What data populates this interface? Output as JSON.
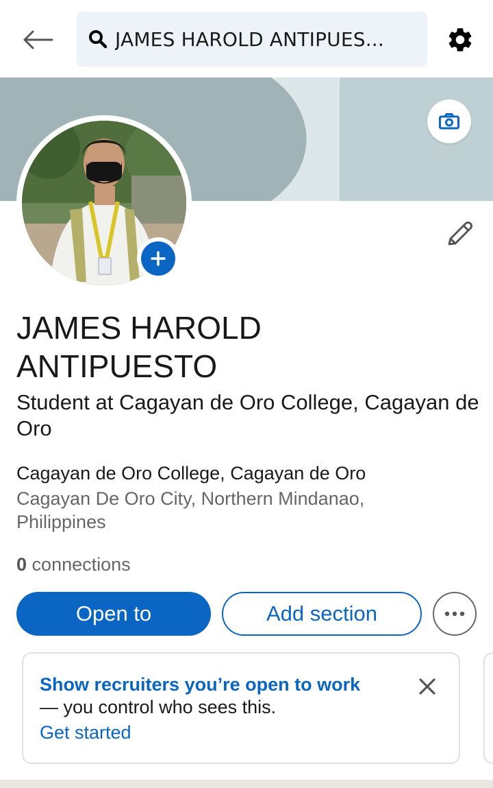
{
  "search": {
    "query": "JAMES HAROLD ANTIPUES..."
  },
  "profile": {
    "name_line1": "JAMES HAROLD",
    "name_line2": "ANTIPUESTO",
    "headline": "Student at Cagayan de Oro College,  Cagayan de Oro",
    "education": "Cagayan de Oro College,  Cagayan de Oro",
    "location": "Cagayan De Oro City, Northern Mindanao, Philippines",
    "connections_count": "0",
    "connections_label": "connections"
  },
  "actions": {
    "open_to": "Open to",
    "add_section": "Add section"
  },
  "open_to_work_card": {
    "title": "Show recruiters you’re open to work",
    "subtitle": "— you control who sees this.",
    "link": "Get started"
  },
  "icons": {
    "back": "arrow-left-icon",
    "search": "search-icon",
    "settings": "gear-icon",
    "camera": "camera-icon",
    "add_photo": "plus-icon",
    "edit": "pencil-icon",
    "more": "ellipsis-icon",
    "close": "close-icon"
  },
  "colors": {
    "brand_blue": "#0a66c2",
    "search_bg": "#edf3f8",
    "banner": "#a0b4b7",
    "secondary_text": "#666666"
  }
}
